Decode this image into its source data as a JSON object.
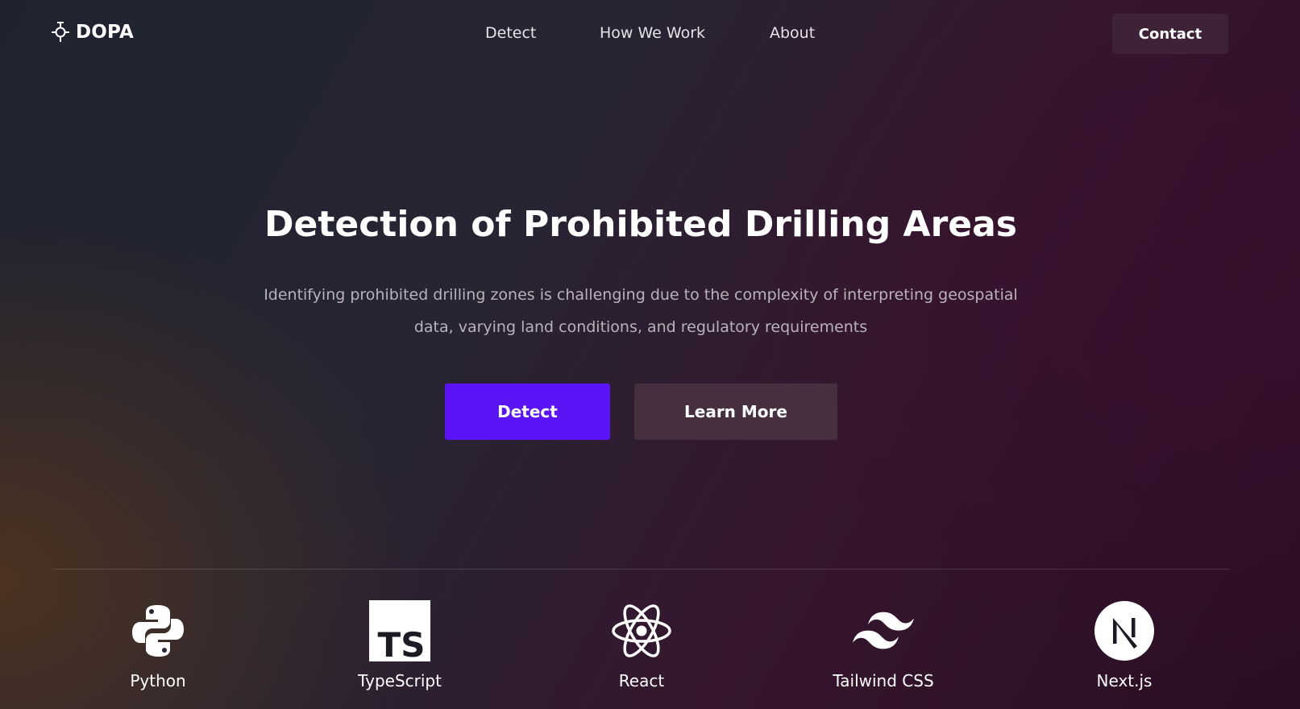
{
  "header": {
    "logo_text": "DOPA",
    "nav": {
      "detect": "Detect",
      "how_we_work": "How We Work",
      "about": "About"
    },
    "contact_label": "Contact"
  },
  "hero": {
    "title": "Detection of Prohibited Drilling Areas",
    "description": "Identifying prohibited drilling zones is challenging due to the complexity of interpreting geospatial data, varying land conditions, and regulatory requirements",
    "primary_button": "Detect",
    "secondary_button": "Learn More"
  },
  "tech_stack": [
    {
      "label": "Python",
      "icon": "python-icon"
    },
    {
      "label": "TypeScript",
      "icon": "typescript-icon"
    },
    {
      "label": "React",
      "icon": "react-icon"
    },
    {
      "label": "Tailwind CSS",
      "icon": "tailwind-icon"
    },
    {
      "label": "Next.js",
      "icon": "nextjs-icon"
    }
  ],
  "colors": {
    "primary_button": "#5b14f5",
    "secondary_button": "#46303f",
    "contact_button": "#3d2238",
    "text_muted": "#b9b2bd"
  }
}
